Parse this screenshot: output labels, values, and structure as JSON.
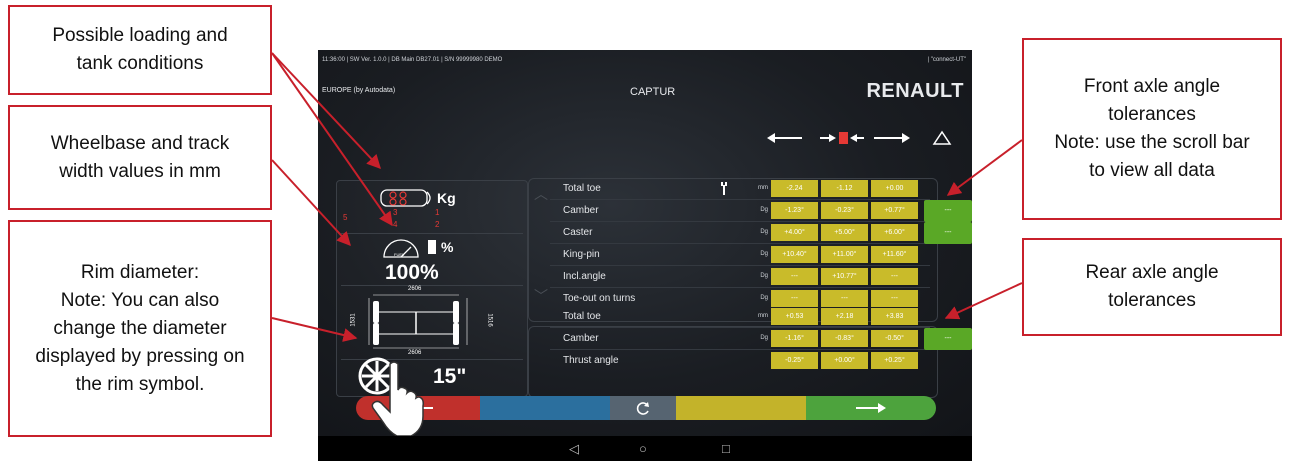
{
  "callouts": {
    "loading": "Possible loading and\ntank conditions",
    "wheelbase": "Wheelbase and track\nwidth values in mm",
    "rim": "Rim diameter:\nNote: You can also\nchange the diameter\ndisplayed by pressing on\nthe rim symbol.",
    "front": "Front axle angle\ntolerances\nNote: use the scroll bar\nto view all data",
    "rear": "Rear axle angle\ntolerances"
  },
  "status_bar": {
    "left": "11:36:00 | SW Ver. 1.0.0 | DB Main DB27.01 | S/N 99999980 DEMO",
    "right": "| \"connect-UT\""
  },
  "header": {
    "region": "EUROPE (by Autodata)",
    "model": "CAPTUR",
    "brand": "RENAULT"
  },
  "left_panel": {
    "weight_unit": "Kg",
    "seat_values": [
      "3",
      "1",
      "4",
      "2"
    ],
    "seat_side_number": "5",
    "tank_symbol": "%",
    "fuel_label": "FUEL",
    "fuel_percent": "100%",
    "wheelbase_top": "2606",
    "wheelbase_bottom": "2606",
    "track_left": "1531",
    "track_right": "1516",
    "rim_diameter": "15\""
  },
  "front_rows": [
    {
      "label": "Total toe",
      "unit": "mm",
      "min": "-2.24",
      "nom": "-1.12",
      "max": "+0.00",
      "button": ""
    },
    {
      "label": "Camber",
      "unit": "Dg",
      "min": "-1.23°",
      "nom": "-0.23°",
      "max": "+0.77°",
      "button": "---"
    },
    {
      "label": "Caster",
      "unit": "Dg",
      "min": "+4.00°",
      "nom": "+5.00°",
      "max": "+6.00°",
      "button": "---"
    },
    {
      "label": "King-pin",
      "unit": "Dg",
      "min": "+10.40°",
      "nom": "+11.00°",
      "max": "+11.60°",
      "button": ""
    },
    {
      "label": "Incl.angle",
      "unit": "Dg",
      "min": "---",
      "nom": "+10.77°",
      "max": "---",
      "button": ""
    },
    {
      "label": "Toe-out on turns",
      "unit": "Dg",
      "min": "---",
      "nom": "---",
      "max": "---",
      "button": ""
    }
  ],
  "rear_rows": [
    {
      "label": "Total toe",
      "unit": "mm",
      "min": "+0.53",
      "nom": "+2.18",
      "max": "+3.83",
      "button": ""
    },
    {
      "label": "Camber",
      "unit": "Dg",
      "min": "-1.16°",
      "nom": "-0.83°",
      "max": "-0.50°",
      "button": "---"
    },
    {
      "label": "Thrust angle",
      "unit": "",
      "min": "-0.25°",
      "nom": "+0.00°",
      "max": "+0.25°",
      "button": ""
    }
  ],
  "colors": {
    "callout_border": "#c8202b",
    "tolerance_yellow": "#c9bb2a",
    "nominal_green": "#5aa826",
    "back_red": "#c0302c",
    "bar_blue": "#2b6f9e",
    "bar_yellow": "#c3b32a",
    "next_green": "#4da33d"
  },
  "icons": [
    "direction-arrows-icon",
    "triangle-up-icon",
    "wrench-icon",
    "seat-layout-icon",
    "fuel-gauge-icon",
    "fuel-pump-icon",
    "axle-diagram-icon",
    "rim-icon",
    "hand-pointer-icon",
    "back-arrow-icon",
    "refresh-icon",
    "next-arrow-icon",
    "nav-back-icon",
    "nav-home-icon",
    "nav-recent-icon"
  ]
}
